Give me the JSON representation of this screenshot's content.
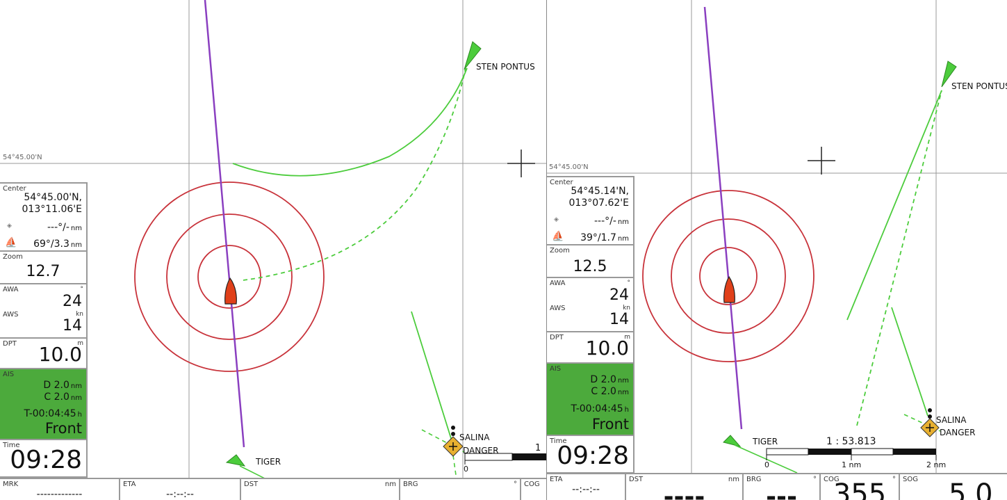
{
  "left": {
    "lat_label": "54°45.00'N",
    "targets": {
      "sten": "STEN PONTUS",
      "salina": "SALINA",
      "danger": "DANGER",
      "tiger": "TIGER"
    },
    "scale_label": "1",
    "scale_zero": "0",
    "center": {
      "title": "Center",
      "lat": "54°45.00'N,",
      "lon": "013°11.06'E",
      "bearing": "---°/-",
      "bearing_unit": "nm",
      "boat": "69°/3.3",
      "boat_unit": "nm"
    },
    "zoom": {
      "title": "Zoom",
      "value": "12.7"
    },
    "wind": {
      "awa_label": "AWA",
      "awa_unit": "°",
      "awa": "24",
      "aws_label": "AWS",
      "aws_unit": "kn",
      "aws": "14"
    },
    "depth": {
      "title": "DPT",
      "unit": "m",
      "value": "10.0"
    },
    "ais": {
      "title": "AIS",
      "d_label": "D",
      "d": "2.0",
      "c_label": "C",
      "c": "2.0",
      "unit": "nm",
      "t": "T-00:04:45",
      "t_unit": "h",
      "dir": "Front"
    },
    "time": {
      "title": "Time",
      "value": "09:28"
    },
    "bottom": {
      "mrk": "MRK",
      "mrk_val": "-------------",
      "eta": "ETA",
      "eta_val": "--:--:--",
      "dst": "DST",
      "dst_unit": "nm",
      "brg": "BRG",
      "brg_unit": "°",
      "cog": "COG"
    }
  },
  "right": {
    "lat_label": "54°45.00'N",
    "targets": {
      "sten": "STEN PONTUS",
      "salina": "SALINA",
      "danger": "DANGER",
      "tiger": "TIGER"
    },
    "scale_ratio": "1 : 53.813",
    "scale_ticks": [
      "0",
      "1 nm",
      "2 nm"
    ],
    "center": {
      "title": "Center",
      "lat": "54°45.14'N,",
      "lon": "013°07.62'E",
      "bearing": "---°/-",
      "bearing_unit": "nm",
      "boat": "39°/1.7",
      "boat_unit": "nm"
    },
    "zoom": {
      "title": "Zoom",
      "value": "12.5"
    },
    "wind": {
      "awa_label": "AWA",
      "awa_unit": "°",
      "awa": "24",
      "aws_label": "AWS",
      "aws_unit": "kn",
      "aws": "14"
    },
    "depth": {
      "title": "DPT",
      "unit": "m",
      "value": "10.0"
    },
    "ais": {
      "title": "AIS",
      "d_label": "D",
      "d": "2.0",
      "c_label": "C",
      "c": "2.0",
      "unit": "nm",
      "t": "T-00:04:45",
      "t_unit": "h",
      "dir": "Front"
    },
    "time": {
      "title": "Time",
      "value": "09:28"
    },
    "bottom": {
      "eta": "ETA",
      "eta_val": "--:--:--",
      "dst": "DST",
      "dst_unit": "nm",
      "dst_val": "----",
      "brg": "BRG",
      "brg_unit": "°",
      "brg_val": "---",
      "cog": "COG",
      "cog_unit": "°",
      "cog_val": "355",
      "sog": "SOG",
      "sog_val": "5.0"
    }
  },
  "colors": {
    "course": "#8a3fc0",
    "ring": "#c8323a",
    "target": "#4ccc3c",
    "boat": "#e0401a",
    "ais_bg": "#4caa3c",
    "danger": "#e8b030"
  }
}
